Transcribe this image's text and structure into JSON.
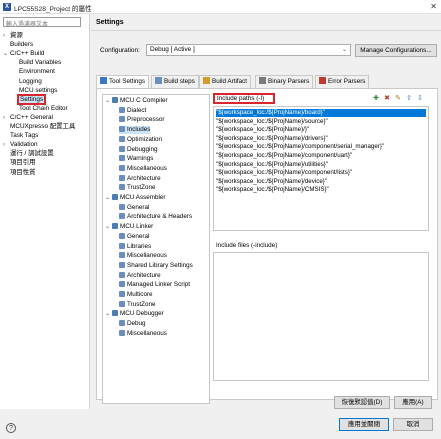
{
  "window": {
    "title": "LPC55S28_Project 的屬性",
    "close_glyph": "✕"
  },
  "sidebar": {
    "filter_placeholder": "輸入過濾器文本",
    "items": [
      {
        "label": "資源",
        "level": 0,
        "chev": "›"
      },
      {
        "label": "Builders",
        "level": 0,
        "chev": ""
      },
      {
        "label": "C/C++ Build",
        "level": 0,
        "chev": "⌄"
      },
      {
        "label": "Build Variables",
        "level": 1,
        "chev": ""
      },
      {
        "label": "Environment",
        "level": 1,
        "chev": ""
      },
      {
        "label": "Logging",
        "level": 1,
        "chev": ""
      },
      {
        "label": "MCU settings",
        "level": 1,
        "chev": ""
      },
      {
        "label": "Settings",
        "level": 1,
        "chev": ""
      },
      {
        "label": "Tool Chain Editor",
        "level": 1,
        "chev": ""
      },
      {
        "label": "C/C++ General",
        "level": 0,
        "chev": "›"
      },
      {
        "label": "MCUXpresso 配置工具",
        "level": 0,
        "chev": ""
      },
      {
        "label": "Task Tags",
        "level": 0,
        "chev": ""
      },
      {
        "label": "Validation",
        "level": 0,
        "chev": "›"
      },
      {
        "label": "運行 / 調試設置",
        "level": 0,
        "chev": ""
      },
      {
        "label": "項目引用",
        "level": 0,
        "chev": ""
      },
      {
        "label": "項目性質",
        "level": 0,
        "chev": ""
      }
    ]
  },
  "main": {
    "title": "Settings",
    "configuration_label": "Configuration:",
    "configuration_value": "Debug  [ Active ]",
    "manage_button": "Manage Configurations...",
    "tabs": [
      {
        "label": "Tool Settings",
        "active": true,
        "icon_color": "#3b78c2"
      },
      {
        "label": "Build steps",
        "active": false,
        "icon_color": "#6a8fc0"
      },
      {
        "label": "Build Artifact",
        "active": false,
        "icon_color": "#d39a2c"
      },
      {
        "label": "Binary Parsers",
        "active": false,
        "icon_color": "#7a7a7a"
      },
      {
        "label": "Error Parsers",
        "active": false,
        "icon_color": "#c0392b"
      }
    ],
    "tool_tree": [
      {
        "label": "MCU C Compiler",
        "level": 0,
        "chev": "⌄"
      },
      {
        "label": "Dialect",
        "level": 1
      },
      {
        "label": "Preprocessor",
        "level": 1
      },
      {
        "label": "Includes",
        "level": 1,
        "selected": true
      },
      {
        "label": "Optimization",
        "level": 1
      },
      {
        "label": "Debugging",
        "level": 1
      },
      {
        "label": "Warnings",
        "level": 1
      },
      {
        "label": "Miscellaneous",
        "level": 1
      },
      {
        "label": "Architecture",
        "level": 1
      },
      {
        "label": "TrustZone",
        "level": 1
      },
      {
        "label": "MCU Assembler",
        "level": 0,
        "chev": "⌄"
      },
      {
        "label": "General",
        "level": 1
      },
      {
        "label": "Architecture & Headers",
        "level": 1
      },
      {
        "label": "MCU Linker",
        "level": 0,
        "chev": "⌄"
      },
      {
        "label": "General",
        "level": 1
      },
      {
        "label": "Libraries",
        "level": 1
      },
      {
        "label": "Miscellaneous",
        "level": 1
      },
      {
        "label": "Shared Library Settings",
        "level": 1
      },
      {
        "label": "Architecture",
        "level": 1
      },
      {
        "label": "Managed Linker Script",
        "level": 1
      },
      {
        "label": "Multicore",
        "level": 1
      },
      {
        "label": "TrustZone",
        "level": 1
      },
      {
        "label": "MCU Debugger",
        "level": 0,
        "chev": "⌄"
      },
      {
        "label": "Debug",
        "level": 1
      },
      {
        "label": "Miscellaneous",
        "level": 1
      }
    ],
    "include_paths_label": "Include paths (-I)",
    "include_paths": [
      "\"${workspace_loc:/${ProjName}/board}\"",
      "\"${workspace_loc:/${ProjName}/source}\"",
      "\"${workspace_loc:/${ProjName}/}\"",
      "\"${workspace_loc:/${ProjName}/drivers}\"",
      "\"${workspace_loc:/${ProjName}/component/serial_manager}\"",
      "\"${workspace_loc:/${ProjName}/component/uart}\"",
      "\"${workspace_loc:/${ProjName}/utilities}\"",
      "\"${workspace_loc:/${ProjName}/component/lists}\"",
      "\"${workspace_loc:/${ProjName}/device}\"",
      "\"${workspace_loc:/${ProjName}/CMSIS}\""
    ],
    "include_files_label": "Include files (-include)",
    "tool_icons": [
      {
        "name": "add-icon",
        "glyph": "✚",
        "color": "#2e8b3a"
      },
      {
        "name": "delete-icon",
        "glyph": "✖",
        "color": "#c0392b"
      },
      {
        "name": "edit-icon",
        "glyph": "✎",
        "color": "#b07a1a"
      },
      {
        "name": "move-up-icon",
        "glyph": "⇧",
        "color": "#3a6fb0"
      },
      {
        "name": "move-down-icon",
        "glyph": "⇩",
        "color": "#3a6fb0"
      }
    ],
    "restore_button": "恢復默認值(D)",
    "apply_button": "應用(A)"
  },
  "footer": {
    "help_glyph": "?",
    "apply_close_button": "應用並關閉",
    "cancel_button": "取消"
  }
}
